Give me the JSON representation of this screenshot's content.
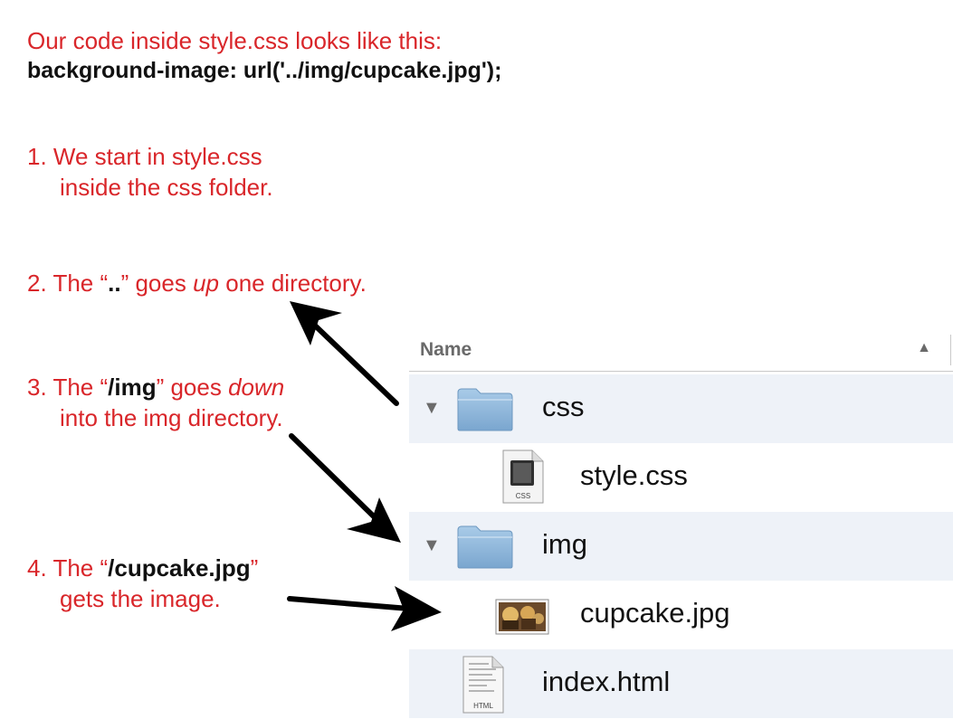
{
  "intro": {
    "lead": "Our code inside style.css looks like this:",
    "code": "background-image: url('../img/cupcake.jpg');"
  },
  "steps": [
    {
      "number": "1.",
      "line1": "We start in style.css",
      "line2": "inside the css folder."
    },
    {
      "number": "2.",
      "pre": "The “",
      "highlight": "..",
      "mid": "” goes ",
      "emph": "up",
      "post": " one directory."
    },
    {
      "number": "3.",
      "pre": "The “",
      "highlight": "/img",
      "mid": "” goes ",
      "emph": "down",
      "line2": "into the img directory."
    },
    {
      "number": "4.",
      "pre": "The “",
      "highlight": "/cupcake.jpg",
      "mid": "”",
      "line2": "gets the image."
    }
  ],
  "finder": {
    "column_header": "Name",
    "sort_icon": "sort-ascending-icon",
    "rows": [
      {
        "name": "css",
        "kind": "folder",
        "icon": "folder-icon",
        "expanded": true
      },
      {
        "name": "style.css",
        "kind": "file",
        "icon": "css-file-icon",
        "badge": "CSS"
      },
      {
        "name": "img",
        "kind": "folder",
        "icon": "folder-icon",
        "expanded": true
      },
      {
        "name": "cupcake.jpg",
        "kind": "image",
        "icon": "image-thumbnail-icon"
      },
      {
        "name": "index.html",
        "kind": "file",
        "icon": "html-file-icon",
        "badge": "HTML"
      }
    ]
  },
  "colors": {
    "annotation_red": "#d9262a",
    "code_black": "#111111",
    "row_stripe": "#eef2f8",
    "folder_blue": "#8fb6d8"
  }
}
